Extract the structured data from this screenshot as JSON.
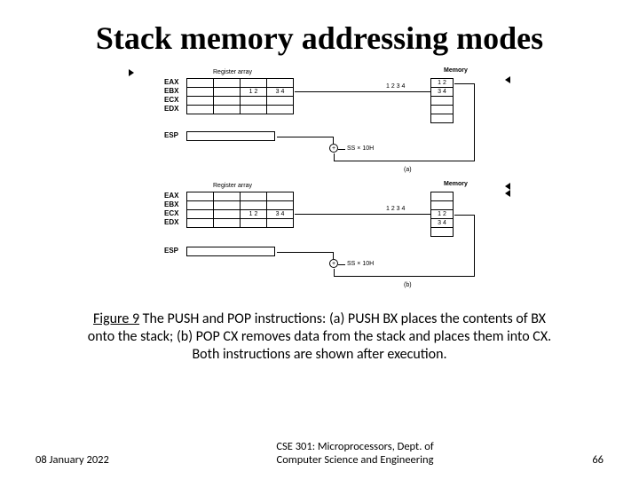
{
  "title": "Stack memory addressing modes",
  "fig": {
    "reg_caption": "Register array",
    "mem_caption": "Memory",
    "regs_a": {
      "r0": "EAX",
      "r1": "EBX",
      "r2": "ECX",
      "r3": "EDX",
      "sp": "ESP"
    },
    "regs_b": {
      "r0": "EAX",
      "r1": "EBX",
      "r2": "ECX",
      "r3": "EDX",
      "sp": "ESP"
    },
    "val12": "1 2",
    "val34": "3 4",
    "buslabel": "1 2 3 4",
    "mem12": "1 2",
    "mem34": "3 4",
    "ssmul": "SS × 10H",
    "pan_a": "(a)",
    "pan_b": "(b)"
  },
  "caption": {
    "lead": "Figure 9",
    "line1": "  The PUSH and POP instructions: (a) PUSH BX places the contents of BX",
    "line2": "onto the stack; (b) POP CX removes data from the stack and places them into CX.",
    "line3": "Both instructions are shown after execution."
  },
  "footer": {
    "date": "08 January 2022",
    "mid1": "CSE 301: Microprocessors, Dept. of",
    "mid2": "Computer Science and Engineering",
    "page": "66"
  }
}
